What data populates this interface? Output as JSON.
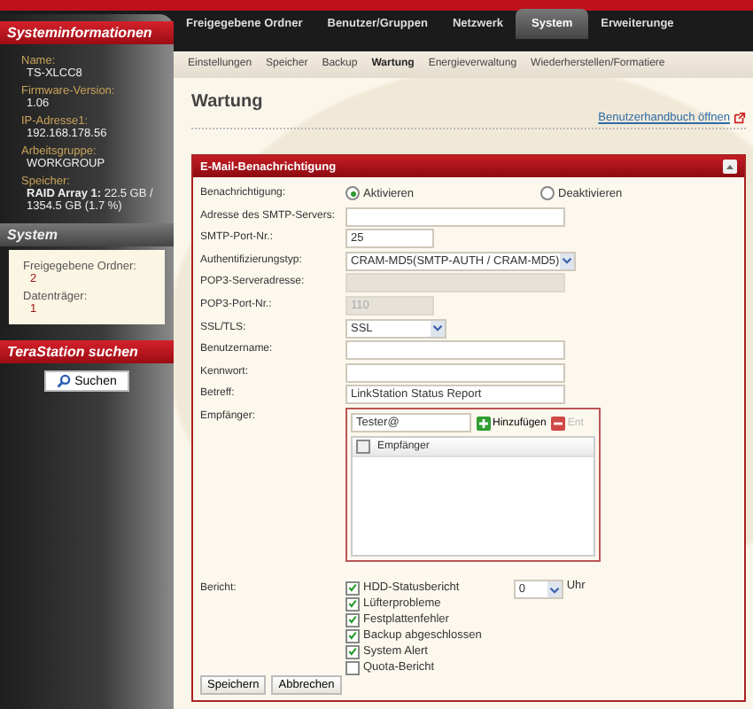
{
  "sidebar": {
    "info": {
      "title": "Systeminformationen",
      "fields": [
        {
          "label": "Name:",
          "value": "TS-XLCC8"
        },
        {
          "label": "Firmware-Version:",
          "value": "1.06"
        },
        {
          "label": "IP-Adresse1:",
          "value": "192.168.178.56"
        },
        {
          "label": "Arbeitsgruppe:",
          "value": "WORKGROUP"
        },
        {
          "label": "Speicher:",
          "value": "**RAID Array 1:** 22.5 GB / 1354.5 GB (1.7 %)"
        }
      ]
    },
    "system": {
      "title": "System",
      "fields": [
        {
          "label": "Freigegebene Ordner:",
          "value": "2"
        },
        {
          "label": "Datenträger:",
          "value": "1"
        }
      ]
    },
    "search": {
      "title": "TeraStation suchen",
      "button": "Suchen"
    }
  },
  "nav_tabs": [
    {
      "label": "Freigegebene Ordner",
      "selected": false
    },
    {
      "label": "Benutzer/Gruppen",
      "selected": false
    },
    {
      "label": "Netzwerk",
      "selected": false
    },
    {
      "label": "System",
      "selected": true
    },
    {
      "label": "Erweiterunge",
      "selected": false
    }
  ],
  "sub_tabs": [
    {
      "label": "Einstellungen",
      "selected": false
    },
    {
      "label": "Speicher",
      "selected": false
    },
    {
      "label": "Backup",
      "selected": false
    },
    {
      "label": "Wartung",
      "selected": true
    },
    {
      "label": "Energieverwaltung",
      "selected": false
    },
    {
      "label": "Wiederherstellen/Formatiere",
      "selected": false
    }
  ],
  "page_title": "Wartung",
  "manual_link": "Benutzerhandbuch öffnen",
  "panel": {
    "title": "E-Mail-Benachrichtigung",
    "rows": [
      {
        "kind": "radio",
        "label": "Benachrichtigung:",
        "options": [
          {
            "label": "Aktivieren",
            "selected": true
          },
          {
            "label": "Deaktivieren",
            "selected": false
          }
        ]
      },
      {
        "kind": "text",
        "label": "Adresse des SMTP-Servers:",
        "disabled": false
      },
      {
        "kind": "text_short",
        "label": "SMTP-Port-Nr.:",
        "value": "25",
        "disabled": false
      },
      {
        "kind": "select",
        "label": "Authentifizierungstyp:",
        "value": "CRAM-MD5(SMTP-AUTH / CRAM-MD5)"
      },
      {
        "kind": "text",
        "label": "POP3-Serveradresse:",
        "disabled": true
      },
      {
        "kind": "text_short",
        "label": "POP3-Port-Nr.:",
        "value": "110",
        "disabled": true
      },
      {
        "kind": "select_short",
        "label": "SSL/TLS:",
        "value": "SSL"
      },
      {
        "kind": "text",
        "label": "Benutzername:",
        "disabled": false
      },
      {
        "kind": "text",
        "label": "Kennwort:",
        "disabled": false
      },
      {
        "kind": "text",
        "label": "Betreff:",
        "value": "LinkStation Status Report",
        "disabled": false
      },
      {
        "kind": "recipients",
        "label": "Empfänger:",
        "input": "Tester@",
        "add": "Hinzufügen",
        "remove": "Ent",
        "column": "Empfänger",
        "header_checked": false
      },
      {
        "kind": "report",
        "label": "Bericht:",
        "time": "0",
        "unit": "Uhr",
        "options": [
          {
            "label": "HDD-Statusbericht",
            "checked": true
          },
          {
            "label": "Lüfterprobleme",
            "checked": true
          },
          {
            "label": "Festplattenfehler",
            "checked": true
          },
          {
            "label": "Backup abgeschlossen",
            "checked": true
          },
          {
            "label": "System Alert",
            "checked": true
          },
          {
            "label": "Quota-Bericht",
            "checked": false
          }
        ]
      }
    ],
    "buttons": [
      "Speichern",
      "Abbrechen"
    ]
  }
}
